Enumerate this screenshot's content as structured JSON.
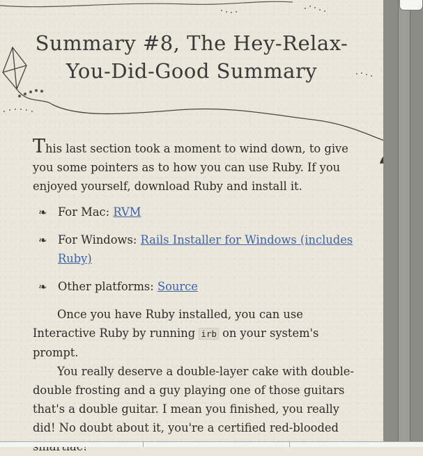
{
  "title": "Summary #8, The Hey-Relax-You-Did-Good Summary",
  "intro": {
    "dropcap": "T",
    "text": "his last section took a moment to wind down, to give you some pointers as to how you can use Ruby. If you enjoyed yourself, download Ruby and install it."
  },
  "links": [
    {
      "label": "For Mac:",
      "link": "RVM"
    },
    {
      "label": "For Windows:",
      "link": "Rails Installer for Windows (includes Ruby)"
    },
    {
      "label": "Other platforms:",
      "link": "Source"
    }
  ],
  "para1": {
    "before": "Once you have Ruby installed, you can use Interactive Ruby by running ",
    "code": "irb",
    "after": " on your system's prompt."
  },
  "para2": "You really deserve a double-layer cake with double-double frosting and a guy playing one of those guitars that's a double guitar. I mean you finished, you really did! No doubt about it, you're a certified red-blooded smartiac!",
  "icons": {
    "bullet": "paw-bullet-icon",
    "kite": "kite-icon",
    "fox": "fox-icon"
  }
}
